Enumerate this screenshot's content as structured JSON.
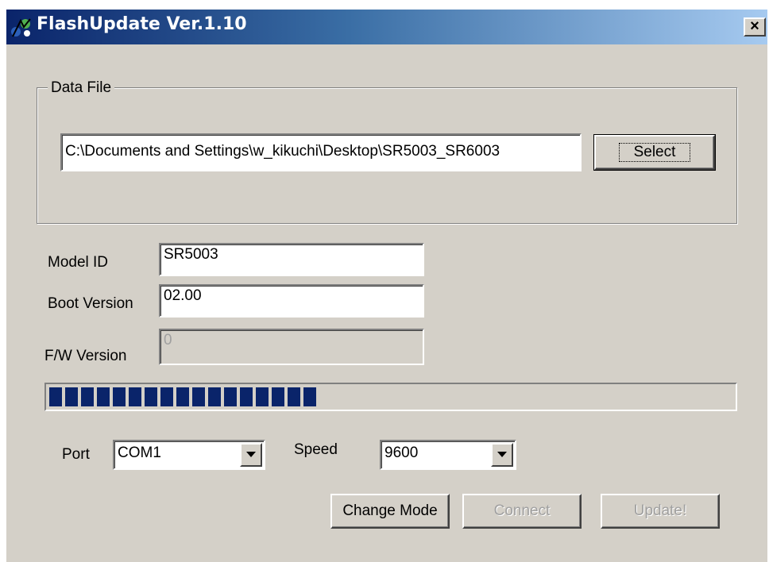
{
  "window": {
    "title": "FlashUpdate Ver.1.10",
    "close_glyph": "×"
  },
  "data_file": {
    "group_label": "Data File",
    "path_value": "C:\\Documents and Settings\\w_kikuchi\\Desktop\\SR5003_SR6003",
    "select_label": "Select"
  },
  "fields": {
    "model_id_label": "Model ID",
    "model_id_value": "SR5003",
    "boot_version_label": "Boot Version",
    "boot_version_value": "02.00",
    "fw_version_label": "F/W Version",
    "fw_version_value": "0"
  },
  "progress": {
    "fraction": 0.39,
    "segments_filled": 17,
    "bar_color": "#0a246a"
  },
  "connection": {
    "port_label": "Port",
    "port_value": "COM1",
    "speed_label": "Speed",
    "speed_value": "9600"
  },
  "actions": {
    "change_mode_label": "Change Mode",
    "connect_label": "Connect",
    "update_label": "Update!"
  },
  "colors": {
    "face": "#d4d0c8",
    "title_gradient_start": "#0a246a",
    "title_gradient_end": "#a6caf0"
  },
  "icons": {
    "app": "flash-update-app-icon",
    "close": "close-icon",
    "dropdown": "chevron-down-icon"
  }
}
